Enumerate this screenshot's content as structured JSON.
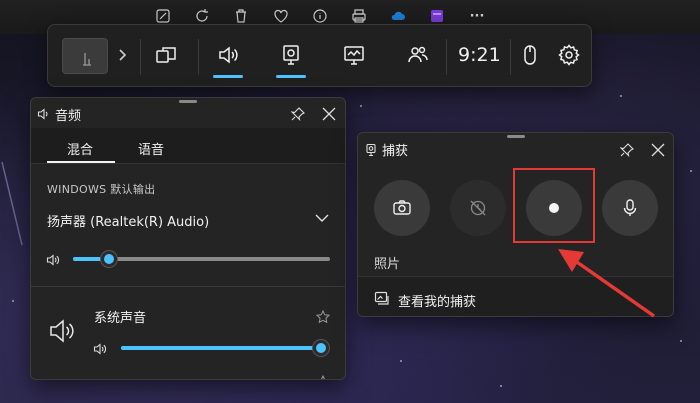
{
  "gamebar": {
    "time": "9:21"
  },
  "audio": {
    "title": "音频",
    "tabs": [
      "混合",
      "语音"
    ],
    "output_label": "WINDOWS 默认输出",
    "device": "扬声器 (Realtek(R) Audio)",
    "master_volume": 0.14,
    "apps": [
      {
        "name": "系统声音",
        "volume": 1.0
      }
    ]
  },
  "capture": {
    "title": "捕获",
    "mode_label": "照片",
    "view_captures": "查看我的捕获"
  },
  "colors": {
    "accent": "#4cc2ff",
    "highlight": "#e53935"
  }
}
